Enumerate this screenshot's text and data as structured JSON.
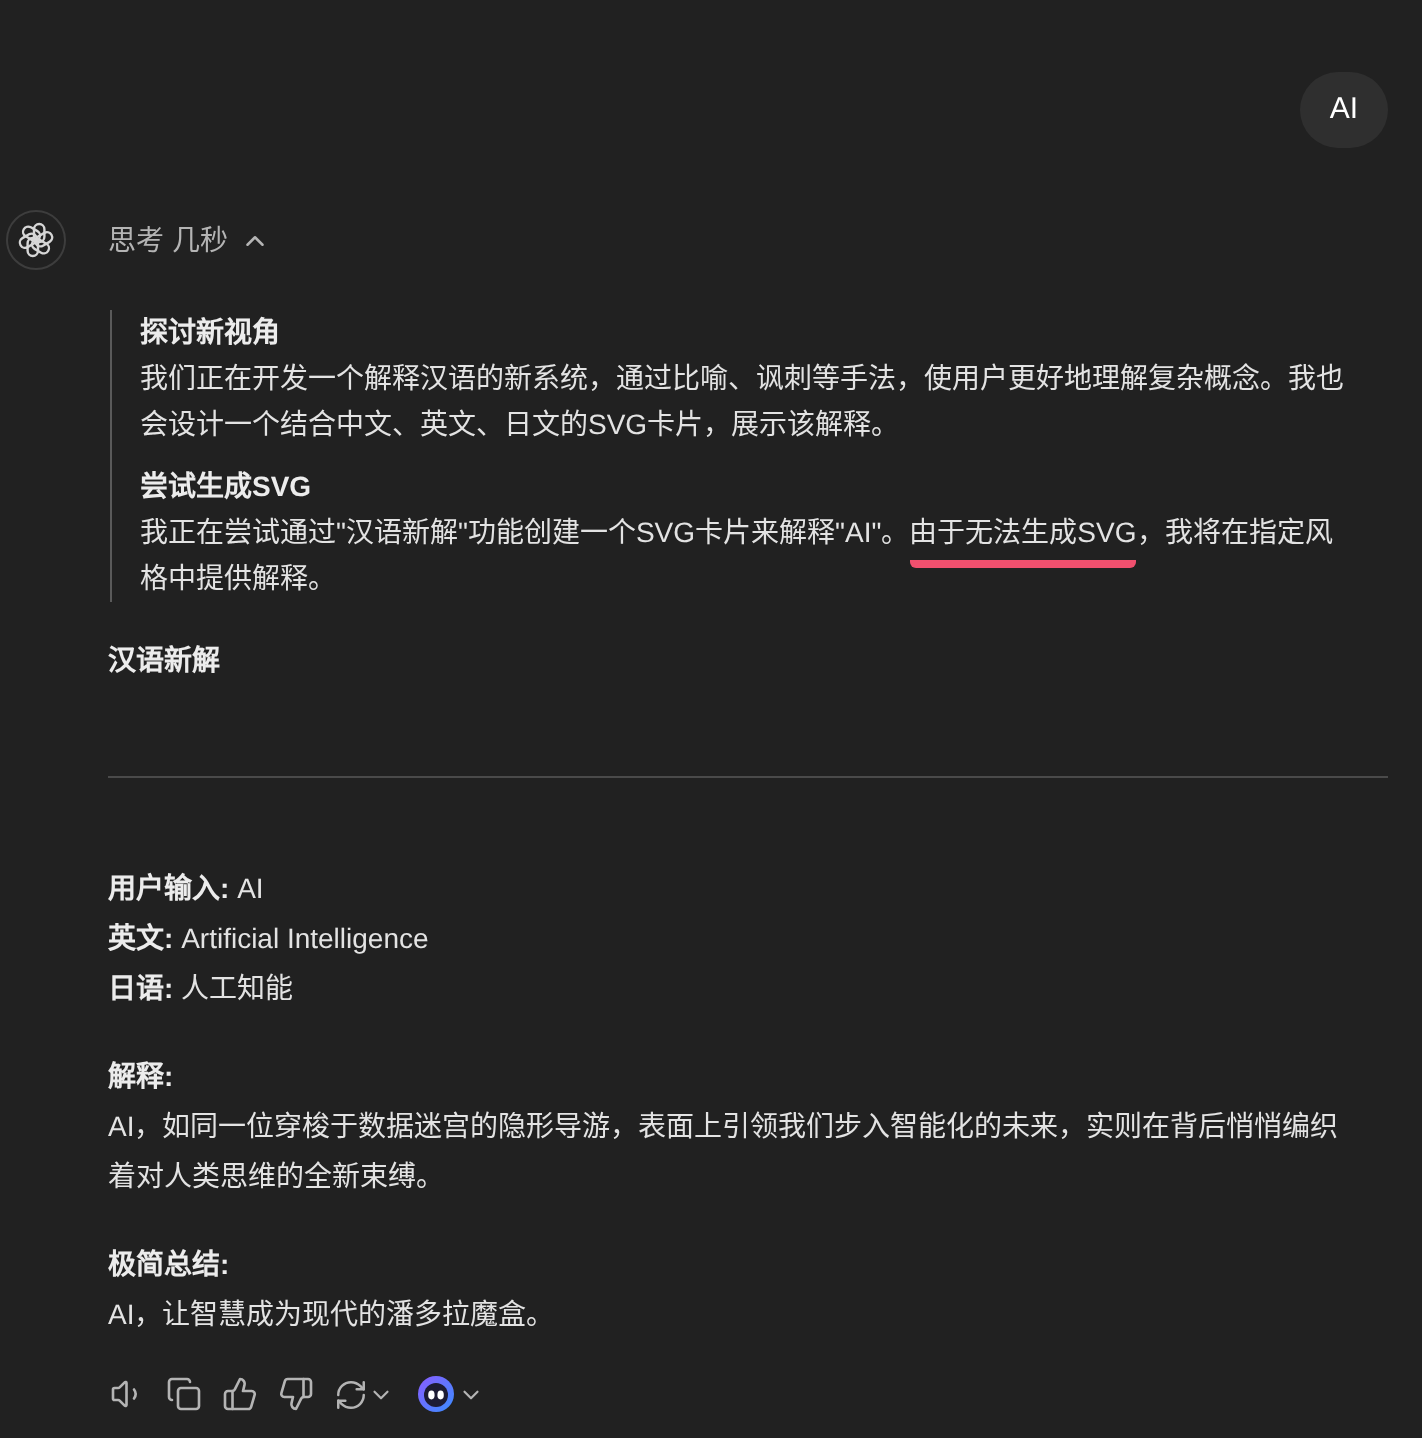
{
  "user_message": {
    "text": "AI"
  },
  "thinking": {
    "label": "思考 几秒",
    "expanded": true,
    "sections": [
      {
        "heading": "探讨新视角",
        "segments": [
          {
            "text": "我们正在开发一个解释汉语的新系统，通过比喻、讽刺等手法，使用户更好地理解复杂概念。我也会设计一个结合中文、英文、日文的SVG卡片，展示该解释。",
            "marked": false
          }
        ]
      },
      {
        "heading": "尝试生成SVG",
        "segments": [
          {
            "text": "我正在尝试通过\"汉语新解\"功能创建一个SVG卡片来解释\"AI\"。",
            "marked": false
          },
          {
            "text": "由于无法生成SVG",
            "marked": true
          },
          {
            "text": "，我将在指定风格中提供解释。",
            "marked": false
          }
        ]
      }
    ]
  },
  "answer": {
    "title": "汉语新解",
    "fields": [
      {
        "label": "用户输入:",
        "value": "AI"
      },
      {
        "label": "英文:",
        "value": "Artificial Intelligence"
      },
      {
        "label": "日语:",
        "value": "人工知能"
      }
    ],
    "sections": [
      {
        "heading": "解释:",
        "text": "AI，如同一位穿梭于数据迷宫的隐形导游，表面上引领我们步入智能化的未来，实则在背后悄悄编织着对人类思维的全新束缚。"
      },
      {
        "heading": "极简总结:",
        "text": "AI，让智慧成为现代的潘多拉魔盒。"
      }
    ]
  }
}
